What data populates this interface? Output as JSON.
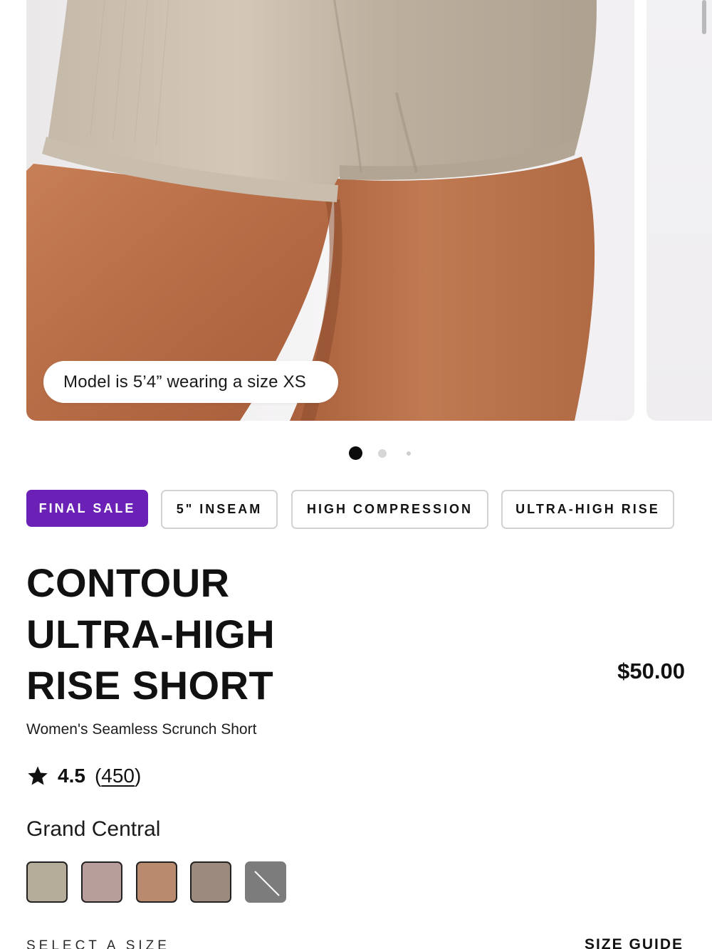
{
  "gallery": {
    "model_caption": "Model is 5’4” wearing a size XS",
    "current_slide": 1,
    "total_slides": 3
  },
  "tags": {
    "final_sale": "FINAL SALE",
    "inseam": "5\" INSEAM",
    "compression": "HIGH COMPRESSION",
    "rise": "ULTRA-HIGH RISE",
    "final_sale_color": "#6b21b6"
  },
  "product": {
    "title_line1": "CONTOUR",
    "title_line2": "ULTRA-HIGH",
    "title_line3": "RISE SHORT",
    "price": "$50.00",
    "subtitle": "Women's Seamless Scrunch Short"
  },
  "rating": {
    "value": "4.5",
    "open_paren": "(",
    "count": "450",
    "close_paren": ")"
  },
  "color": {
    "selected_name": "Grand Central",
    "swatches": [
      {
        "name": "swatch-1",
        "hex": "#b5ad9a"
      },
      {
        "name": "swatch-2",
        "hex": "#b89e9a"
      },
      {
        "name": "swatch-3",
        "hex": "#b98a6e"
      },
      {
        "name": "swatch-4",
        "hex": "#9c8a7e"
      },
      {
        "name": "swatch-5-unavailable",
        "hex": "#7c7c7c"
      }
    ]
  },
  "size": {
    "select_label": "SELECT A SIZE",
    "guide_label": "SIZE GUIDE"
  }
}
